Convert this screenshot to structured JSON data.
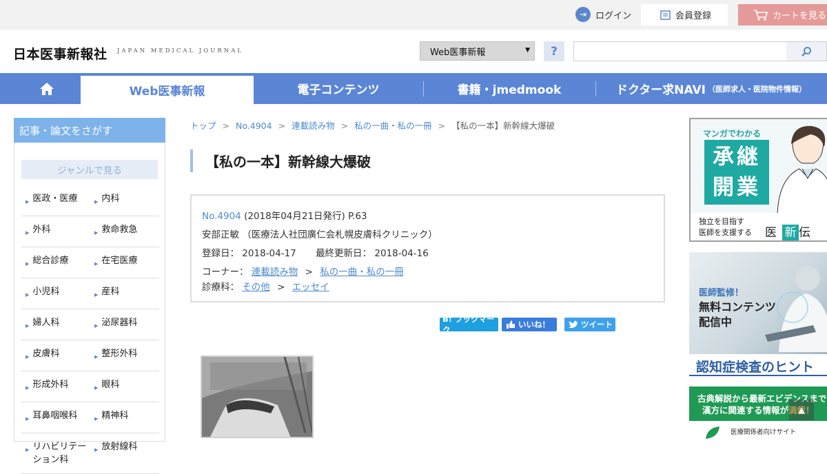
{
  "utility": {
    "login": "ログイン",
    "member_register": "会員登録",
    "cart": "カートを見る"
  },
  "header": {
    "logo": "日本医事新報社",
    "logo_sub": "JAPAN MEDICAL JOURNAL",
    "site_select": "Web医事新報",
    "help": "?",
    "search_value": ""
  },
  "nav": {
    "web": "Web医事新報",
    "econtents": "電子コンテンツ",
    "books": "書籍・jmedmook",
    "doctor": "ドクター求NAVI",
    "doctor_sub": "（医師求人・医院物件情報）"
  },
  "sidebar": {
    "heading": "記事・論文をさがす",
    "genre_button": "ジャンルで見る",
    "genres": [
      [
        "医政・医療",
        "内科"
      ],
      [
        "外科",
        "救命救急"
      ],
      [
        "総合診療",
        "在宅医療"
      ],
      [
        "小児科",
        "産科"
      ],
      [
        "婦人科",
        "泌尿器科"
      ],
      [
        "皮膚科",
        "整形外科"
      ],
      [
        "形成外科",
        "眼科"
      ],
      [
        "耳鼻咽喉科",
        "精神科"
      ],
      [
        "リハビリテーション科",
        "放射線科"
      ]
    ]
  },
  "breadcrumb": {
    "top": "トップ",
    "issue": "No.4904",
    "series": "連載読み物",
    "corner": "私の一曲・私の一冊",
    "current": "【私の一本】新幹線大爆破",
    "sep": ">"
  },
  "article": {
    "title": "【私の一本】新幹線大爆破",
    "issue_link": "No.4904",
    "issue_meta": "(2018年04月21日発行) P.63",
    "author": "安部正敏 （医療法人社団廣仁会札幌皮膚科クリニック）",
    "registered_label": "登録日：",
    "registered": "2018-04-17",
    "updated_label": "最終更新日：",
    "updated": "2018-04-16",
    "corner_label": "コーナー：",
    "corner_1": "連載読み物",
    "corner_2": "私の一曲・私の一冊",
    "dept_label": "診療科：",
    "dept_1": "その他",
    "dept_2": "エッセイ",
    "sep": ">"
  },
  "share": {
    "hatena": "B! ブックマーク",
    "facebook": "いいね！",
    "twitter": "ツイート"
  },
  "ads": {
    "ad1_title": "マンガでわかる",
    "ad1_block": "承継開業",
    "ad1_line1": "独立を目指す",
    "ad1_line2": "医師を支援する",
    "ad1_brand_a": "医",
    "ad1_brand_b": "新",
    "ad1_brand_c": "伝",
    "ad2_small": "医師監修！",
    "ad2_line1": "無料コンテンツ",
    "ad2_line2": "配信中",
    "ad2_bottom": "認知症検査のヒント",
    "ad3_line1": "古典解説から最新エビデンスまで",
    "ad3_line2a": "漢方に関連する情報が",
    "ad3_line2b": "満載",
    "ad3_foot": "医療関係者向けサイト"
  },
  "colors": {
    "nav_blue": "#5b86d6",
    "link_blue": "#4d8ad0",
    "sidebar_head": "#7eb2ea",
    "cart_pink": "#e59a9a"
  }
}
